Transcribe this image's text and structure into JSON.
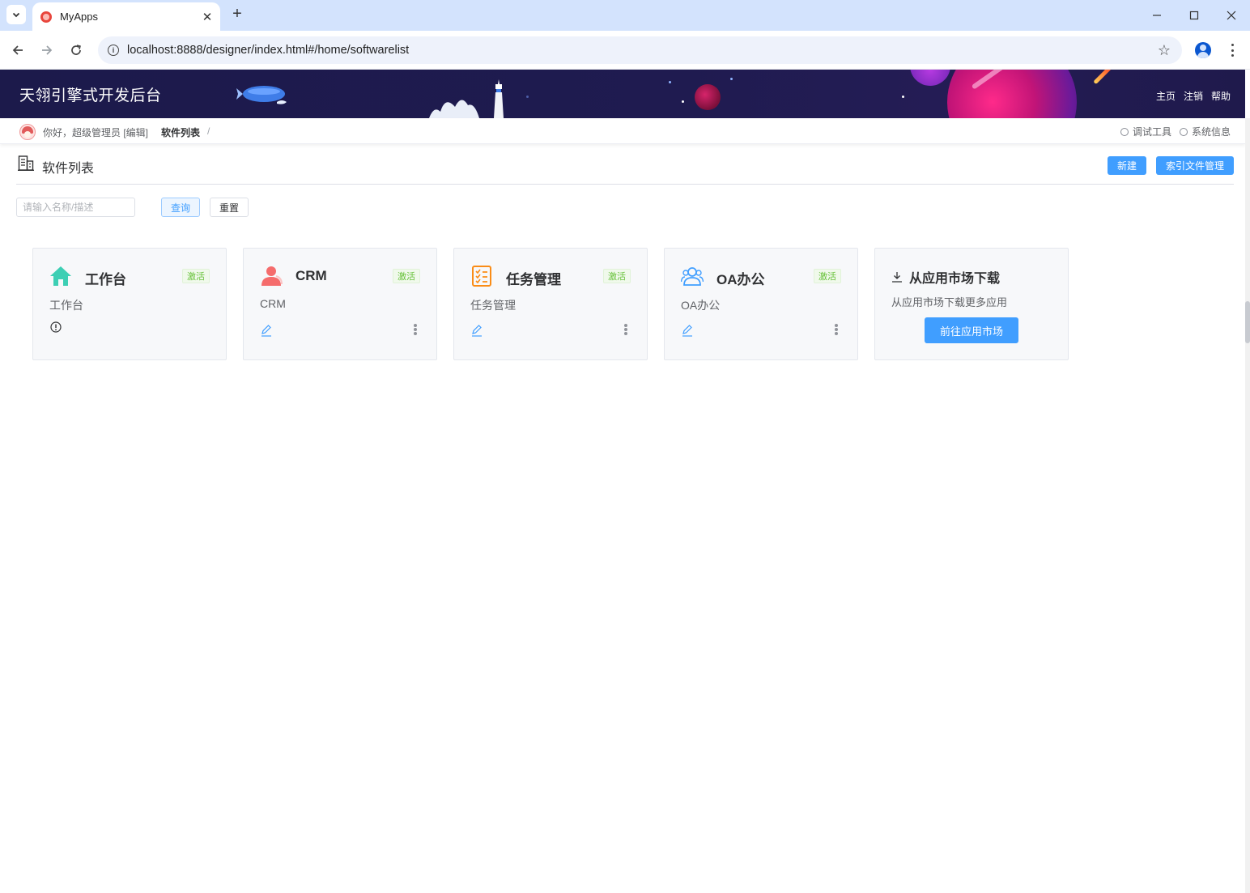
{
  "browser": {
    "tab_title": "MyApps",
    "url": "localhost:8888/designer/index.html#/home/softwarelist"
  },
  "header": {
    "app_title": "天翎引擎式开发后台",
    "links": [
      "主页",
      "注销",
      "帮助"
    ]
  },
  "crumbbar": {
    "greeting": "你好，超级管理员 [编辑]",
    "current": "软件列表",
    "separator": "/",
    "tools": [
      "调试工具",
      "系统信息"
    ]
  },
  "page": {
    "title": "软件列表",
    "new_button": "新建",
    "index_button": "索引文件管理",
    "search_placeholder": "请输入名称/描述",
    "query_button": "查询",
    "reset_button": "重置"
  },
  "cards": [
    {
      "name": "工作台",
      "badge": "激活",
      "desc": "工作台",
      "icon": "home-icon",
      "color": "#3dcfb4"
    },
    {
      "name": "CRM",
      "badge": "激活",
      "desc": "CRM",
      "icon": "user-icon",
      "color": "#f56c6c"
    },
    {
      "name": "任务管理",
      "badge": "激活",
      "desc": "任务管理",
      "icon": "checklist-icon",
      "color": "#fa8c16"
    },
    {
      "name": "OA办公",
      "badge": "激活",
      "desc": "OA办公",
      "icon": "group-icon",
      "color": "#409eff"
    }
  ],
  "market": {
    "title": "从应用市场下载",
    "desc": "从应用市场下载更多应用",
    "button": "前往应用市场"
  },
  "colors": {
    "primary": "#409eff",
    "banner": "#1c1a4b",
    "success": "#67c23a"
  }
}
